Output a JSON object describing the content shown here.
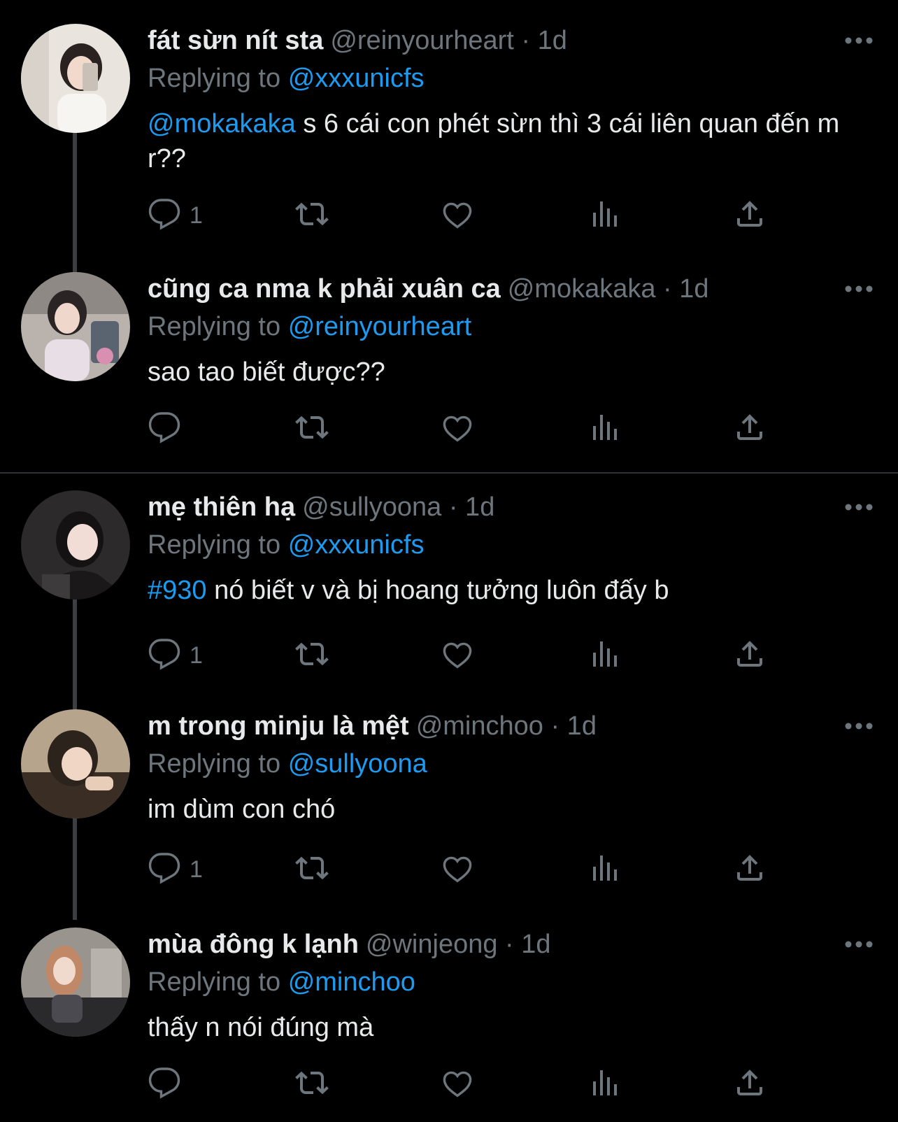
{
  "colors": {
    "background": "#000000",
    "text": "#e7e9ea",
    "muted": "#6e767d",
    "accent": "#1d9bf0",
    "divider": "#2f3336"
  },
  "tweets": [
    {
      "display_name": "fát sừn nít sta",
      "meta": "@reinyourheart · 1d",
      "replying_prefix": "Replying to",
      "replying_to": "@xxxunicfs",
      "body_lead": "@mokakaka",
      "body_text": " s 6 cái con phét sừn thì 3 cái liên quan đến m r??",
      "reply_count": "1",
      "icons": [
        "reply-icon",
        "retweet-icon",
        "like-icon",
        "views-icon",
        "share-icon",
        "more-icon"
      ]
    },
    {
      "display_name": "cũng ca nma k phải xuân ca",
      "meta": "@mokakaka · 1d",
      "replying_prefix": "Replying to",
      "replying_to": "@reinyourheart",
      "body_lead": "",
      "body_text": "sao tao biết được??",
      "reply_count": "",
      "icons": [
        "reply-icon",
        "retweet-icon",
        "like-icon",
        "views-icon",
        "share-icon",
        "more-icon"
      ]
    },
    {
      "display_name": "mẹ thiên hạ",
      "meta": "@sullyoona · 1d",
      "replying_prefix": "Replying to",
      "replying_to": "@xxxunicfs",
      "body_lead": "#930",
      "body_text": " nó biết v và bị hoang tưởng luôn đấy b",
      "reply_count": "1",
      "icons": [
        "reply-icon",
        "retweet-icon",
        "like-icon",
        "views-icon",
        "share-icon",
        "more-icon"
      ]
    },
    {
      "display_name": "m trong minju là mệt",
      "meta": "@minchoo · 1d",
      "replying_prefix": "Replying to",
      "replying_to": "@sullyoona",
      "body_lead": "",
      "body_text": "im dùm con chó",
      "reply_count": "1",
      "icons": [
        "reply-icon",
        "retweet-icon",
        "like-icon",
        "views-icon",
        "share-icon",
        "more-icon"
      ]
    },
    {
      "display_name": "mùa đông k lạnh",
      "meta": "@winjeong · 1d",
      "replying_prefix": "Replying to",
      "replying_to": "@minchoo",
      "body_lead": "",
      "body_text": "thấy n nói đúng mà",
      "reply_count": "",
      "icons": [
        "reply-icon",
        "retweet-icon",
        "like-icon",
        "views-icon",
        "share-icon",
        "more-icon"
      ]
    }
  ]
}
